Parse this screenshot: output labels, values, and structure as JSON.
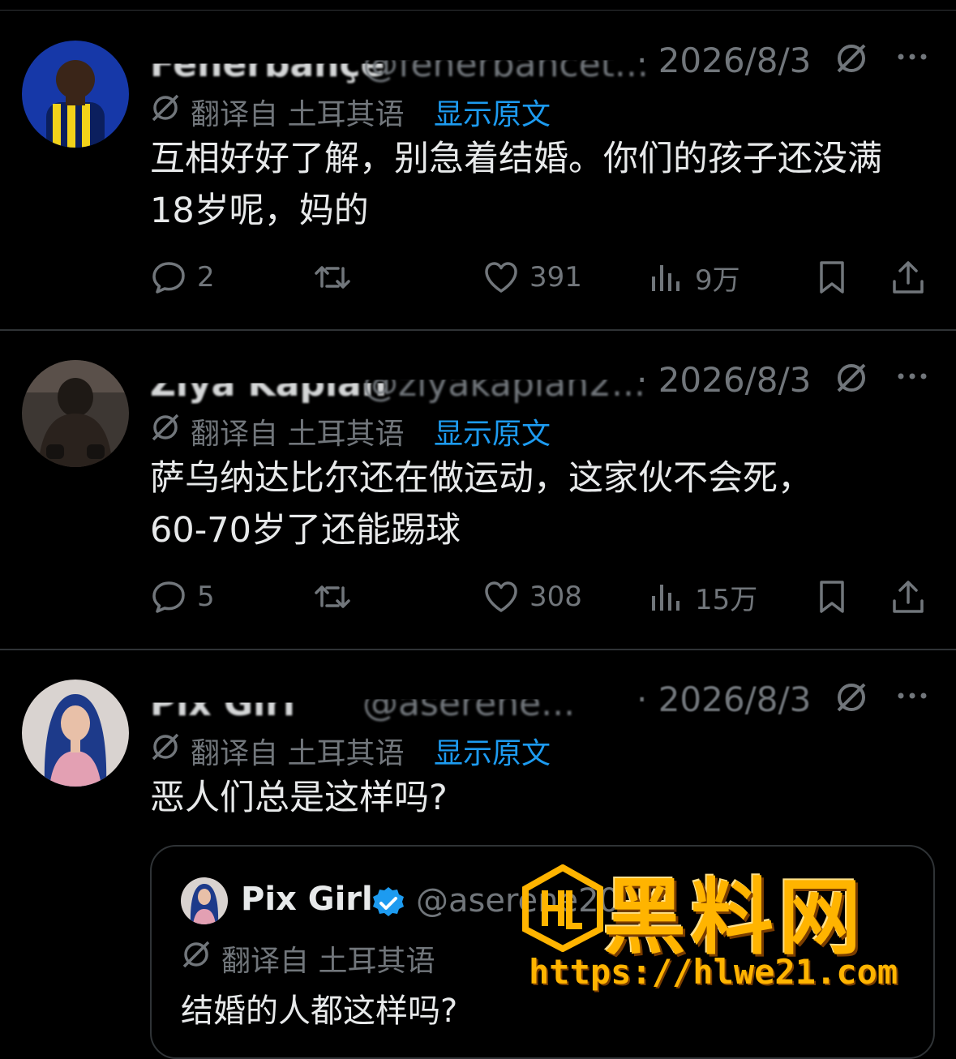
{
  "tweets": [
    {
      "name": "Fenerbahçe",
      "handle": "@fenerbahcet...",
      "date": "· 2026/8/3",
      "translated_label": "翻译自 土耳其语",
      "show_original": "显示原文",
      "text_line1": "互相好好了解，别急着结婚。你们的孩子还没满",
      "text_line2": "18岁呢，妈的",
      "replies": "2",
      "likes": "391",
      "views": "9万"
    },
    {
      "name": "Ziya Kaplan",
      "handle": "@ziyakaplan2...",
      "date": "· 2026/8/3",
      "translated_label": "翻译自 土耳其语",
      "show_original": "显示原文",
      "text_line1": "萨乌纳达比尔还在做运动，这家伙不会死，",
      "text_line2": "60-70岁了还能踢球",
      "replies": "5",
      "likes": "308",
      "views": "15万"
    },
    {
      "name": "Pix Girl",
      "handle": "@aserene...",
      "date": "· 2026/8/3",
      "translated_label": "翻译自 土耳其语",
      "show_original": "显示原文",
      "text_line1": "恶人们总是这样吗?"
    }
  ],
  "quote": {
    "name": "Pix Girl",
    "handle": "@aserene20",
    "translated_label": "翻译自 土耳其语",
    "text": "结婚的人都这样吗?"
  },
  "watermark": {
    "title": "黑料网",
    "url": "https://hlwe21.com"
  },
  "colors": {
    "background": "#000000",
    "text": "#e7e9ea",
    "muted": "#71767b",
    "link": "#1d9bf0",
    "watermark": "#ffb400"
  },
  "icons": [
    "reply-icon",
    "retweet-icon",
    "like-icon",
    "views-icon",
    "bookmark-icon",
    "share-icon",
    "grok-icon",
    "more-icon",
    "translate-icon",
    "verified-icon"
  ]
}
